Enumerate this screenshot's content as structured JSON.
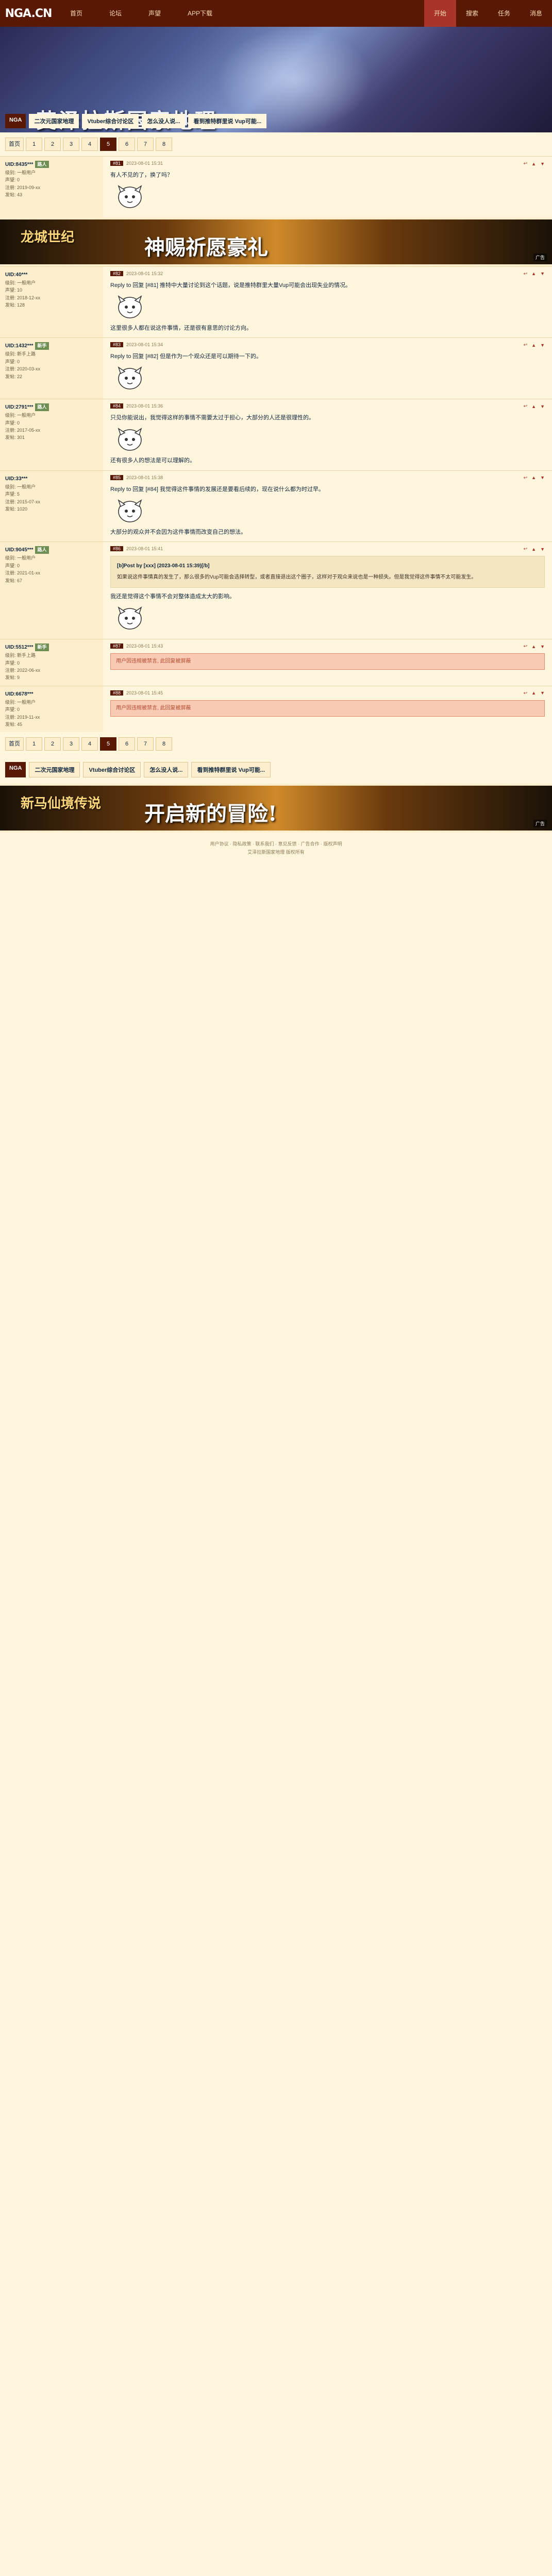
{
  "header": {
    "logo": "NGA.CN",
    "logo_sub": "艾泽拉斯国家地理",
    "nav": [
      "首页",
      "论坛",
      "声望",
      "APP下载"
    ],
    "right_nav": [
      "开始",
      "搜索",
      "任务",
      "消息"
    ]
  },
  "banner": {
    "title": "艾泽拉斯国家地理",
    "crumbs_home": "NGA",
    "crumbs": [
      "二次元国家地理",
      "Vtuber综合讨论区",
      "怎么没人说...",
      "看到推特群里说 Vup可能..."
    ]
  },
  "pager": [
    "首页",
    "1",
    "2",
    "3",
    "4",
    "5",
    "6",
    "7",
    "8"
  ],
  "pager_current": 5,
  "ad1": {
    "logo": "龙城世纪",
    "title": "神赐祈愿豪礼",
    "tag": "广告"
  },
  "ad2": {
    "logo": "新马仙境传说",
    "title": "开启新的冒险!",
    "tag": "广告"
  },
  "posts": [
    {
      "user": "UID:8435***",
      "badge": "路人",
      "lvl": "级别: 一般用户",
      "rep": "声望: 0",
      "reg": "注册: 2019-09-xx",
      "posts": "发帖: 43",
      "floor": "#81",
      "time": "2023-08-01 15:31",
      "content": "有人不见的了，换了吗？",
      "content2": "",
      "quote": "",
      "quote_head": "",
      "redbox": ""
    },
    {
      "user": "UID:40***",
      "badge": "",
      "lvl": "级别: 一般用户",
      "rep": "声望: 10",
      "reg": "注册: 2018-12-xx",
      "posts": "发帖: 128",
      "floor": "#82",
      "time": "2023-08-01 15:32",
      "content": "Reply to 回复 [#81] 推特中大量讨论到这个话题，说是推特群里大量Vup可能会出现失业的情况。",
      "content2": "这里很多人都在说这件事情，还是很有意思的讨论方向。",
      "quote": "",
      "quote_head": "",
      "redbox": ""
    },
    {
      "user": "UID:1432***",
      "badge": "新手",
      "lvl": "级别: 新手上路",
      "rep": "声望: 0",
      "reg": "注册: 2020-03-xx",
      "posts": "发帖: 22",
      "floor": "#83",
      "time": "2023-08-01 15:34",
      "content": "Reply to 回复 [#82] 但是作为一个观众还是可以期待一下的。",
      "content2": "",
      "quote": "",
      "quote_head": "",
      "redbox": ""
    },
    {
      "user": "UID:2791***",
      "badge": "路人",
      "lvl": "级别: 一般用户",
      "rep": "声望: 0",
      "reg": "注册: 2017-05-xx",
      "posts": "发帖: 301",
      "floor": "#84",
      "time": "2023-08-01 15:36",
      "content": "只见你能说出，我觉得这样的事情不需要太过于担心，大部分的人还是很理性的。",
      "content2": "还有很多人的想法是可以理解的。",
      "quote": "",
      "quote_head": "",
      "redbox": ""
    },
    {
      "user": "UID:33***",
      "badge": "",
      "lvl": "级别: 一般用户",
      "rep": "声望: 5",
      "reg": "注册: 2015-07-xx",
      "posts": "发帖: 1020",
      "floor": "#85",
      "time": "2023-08-01 15:38",
      "content": "Reply to 回复 [#84] 我觉得这件事情的发展还是要看后续的，现在说什么都为时过早。",
      "content2": "大部分的观众并不会因为这件事情而改变自己的想法。",
      "quote": "",
      "quote_head": "",
      "redbox": ""
    },
    {
      "user": "UID:9045***",
      "badge": "路人",
      "lvl": "级别: 一般用户",
      "rep": "声望: 0",
      "reg": "注册: 2021-01-xx",
      "posts": "发帖: 67",
      "floor": "#86",
      "time": "2023-08-01 15:41",
      "content": "我还是觉得这个事情不会对整体造成太大的影响。",
      "content2": "",
      "quote": "如果说这件事情真的发生了，那么很多的Vup可能会选择转型，或者直接退出这个圈子，这样对于观众来说也是一种损失。但是我觉得这件事情不太可能发生。",
      "quote_head": "[b]Post by [xxx] (2023-08-01 15:39)[/b]",
      "redbox": ""
    },
    {
      "user": "UID:5512***",
      "badge": "新手",
      "lvl": "级别: 新手上路",
      "rep": "声望: 0",
      "reg": "注册: 2022-06-xx",
      "posts": "发帖: 9",
      "floor": "#87",
      "time": "2023-08-01 15:43",
      "content": "",
      "content2": "",
      "quote": "",
      "quote_head": "",
      "redbox": "用户因违规被禁言, 此回复被屏蔽"
    },
    {
      "user": "UID:6678***",
      "badge": "",
      "lvl": "级别: 一般用户",
      "rep": "声望: 0",
      "reg": "注册: 2019-11-xx",
      "posts": "发帖: 45",
      "floor": "#88",
      "time": "2023-08-01 15:45",
      "content": "",
      "content2": "",
      "quote": "",
      "quote_head": "",
      "redbox": "用户因违规被禁言, 此回复被屏蔽"
    }
  ],
  "bottom_crumbs_home": "NGA",
  "footer_lines": [
    "用户协议 · 隐私政策 · 联系我们 · 意见反馈 · 广告合作 · 版权声明",
    "艾泽拉斯国家地理 版权所有"
  ]
}
